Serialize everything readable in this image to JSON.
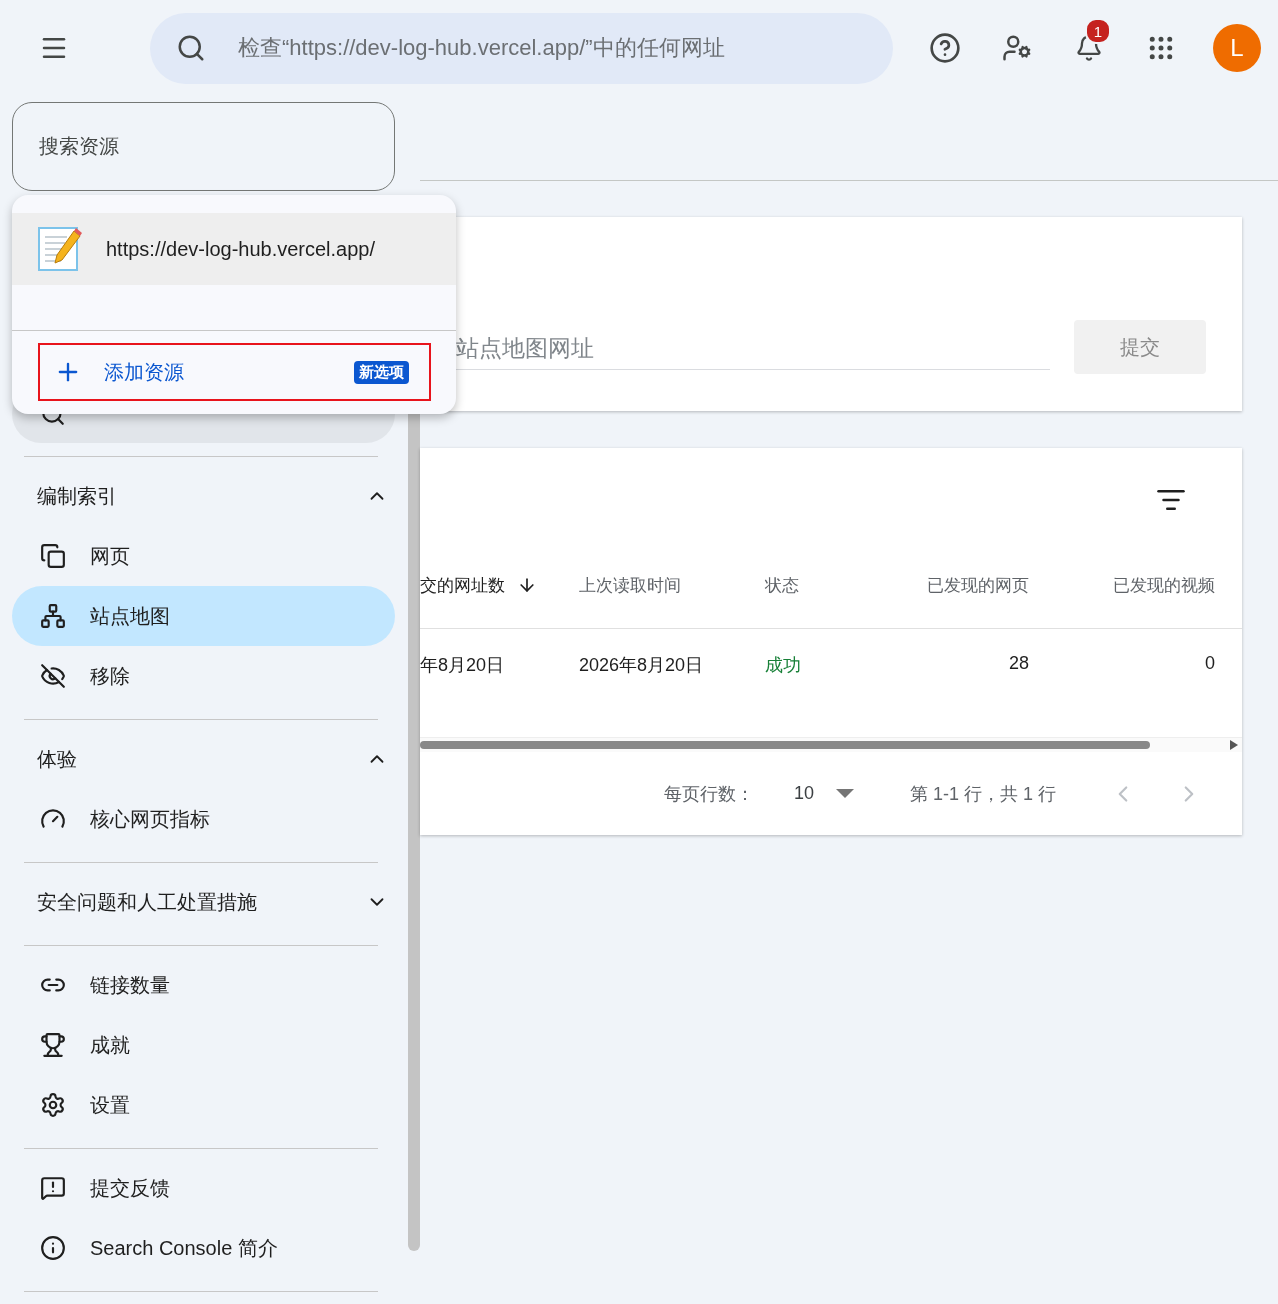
{
  "top_bar": {
    "search_placeholder": "检查“https://dev-log-hub.vercel.app/”中的任何网址",
    "notification_count": "1",
    "avatar_letter": "L"
  },
  "resource_search": {
    "placeholder": "搜索资源"
  },
  "resource_menu": {
    "items": [
      {
        "url": "https://dev-log-hub.vercel.app/",
        "selected": true
      }
    ],
    "add_button": {
      "label": "添加资源",
      "badge": "新选项",
      "highlighted": true
    }
  },
  "sidebar": {
    "sections": [
      {
        "kind": "group",
        "title": "编制索引",
        "expanded": true,
        "items": [
          {
            "label": "网页",
            "selected": false
          },
          {
            "label": "站点地图",
            "selected": true
          },
          {
            "label": "移除",
            "selected": false
          }
        ]
      },
      {
        "kind": "group",
        "title": "体验",
        "expanded": true,
        "items": [
          {
            "label": "核心网页指标",
            "selected": false
          }
        ]
      },
      {
        "kind": "group",
        "title": "安全问题和人工处置措施",
        "expanded": false
      },
      {
        "kind": "list",
        "items": [
          {
            "label": "链接数量",
            "selected": false
          },
          {
            "label": "成就",
            "selected": false
          },
          {
            "label": "设置",
            "selected": false
          }
        ]
      },
      {
        "kind": "list",
        "items": [
          {
            "label": "提交反馈",
            "selected": false
          },
          {
            "label": "Search Console 简介",
            "selected": false
          }
        ]
      }
    ]
  },
  "sitemap_form": {
    "placeholder": "站点地图网址",
    "submit": {
      "label": "提交",
      "disabled": true
    }
  },
  "table": {
    "columns": [
      {
        "label": "交的网址数",
        "sorted": true
      },
      {
        "label": "上次读取时间",
        "sorted": false
      },
      {
        "label": "状态",
        "sorted": false
      },
      {
        "label": "已发现的网页",
        "sorted": false
      },
      {
        "label": "已发现的视频",
        "sorted": false
      }
    ],
    "rows": [
      {
        "cells": [
          "年8月20日",
          "2026年8月20日",
          "成功",
          "28",
          "0"
        ],
        "succeeded": true
      }
    ]
  },
  "pagination": {
    "rows_per_page_label": "每页行数：",
    "rows_per_page": "10",
    "range": "第 1-1 行，共 1 行",
    "prev_disabled": true,
    "next_disabled": true
  }
}
